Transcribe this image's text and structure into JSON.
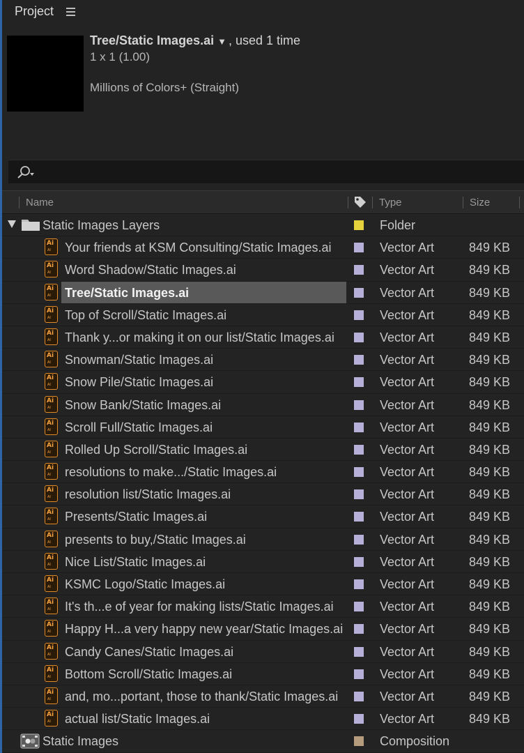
{
  "panel": {
    "title": "Project"
  },
  "info": {
    "file_name": "Tree/Static Images.ai",
    "arrow": "▼",
    "usage": ", used 1 time",
    "dimensions": "1 x 1 (1.00)",
    "color_depth": "Millions of Colors+ (Straight)"
  },
  "search": {
    "value": ""
  },
  "columns": {
    "name": "Name",
    "type": "Type",
    "size": "Size"
  },
  "colors": {
    "folder_label": "#e6d23c",
    "vector_label": "#b6b0d8",
    "comp_label": "#b49c7c",
    "accent": "#2f64a6"
  },
  "folder": {
    "name": "Static Images Layers",
    "type": "Folder",
    "icon": "folder-icon"
  },
  "items": [
    {
      "name": "Your friends at KSM Consulting/Static Images.ai",
      "type": "Vector Art",
      "size": "849 KB"
    },
    {
      "name": "Word Shadow/Static Images.ai",
      "type": "Vector Art",
      "size": "849 KB"
    },
    {
      "name": "Tree/Static Images.ai",
      "type": "Vector Art",
      "size": "849 KB",
      "selected": true
    },
    {
      "name": "Top of Scroll/Static Images.ai",
      "type": "Vector Art",
      "size": "849 KB"
    },
    {
      "name": "Thank y...or making it on our list/Static Images.ai",
      "type": "Vector Art",
      "size": "849 KB"
    },
    {
      "name": "Snowman/Static Images.ai",
      "type": "Vector Art",
      "size": "849 KB"
    },
    {
      "name": "Snow Pile/Static Images.ai",
      "type": "Vector Art",
      "size": "849 KB"
    },
    {
      "name": "Snow Bank/Static Images.ai",
      "type": "Vector Art",
      "size": "849 KB"
    },
    {
      "name": "Scroll Full/Static Images.ai",
      "type": "Vector Art",
      "size": "849 KB"
    },
    {
      "name": "Rolled Up Scroll/Static Images.ai",
      "type": "Vector Art",
      "size": "849 KB"
    },
    {
      "name": "resolutions to make.../Static Images.ai",
      "type": "Vector Art",
      "size": "849 KB"
    },
    {
      "name": "resolution list/Static Images.ai",
      "type": "Vector Art",
      "size": "849 KB"
    },
    {
      "name": "Presents/Static Images.ai",
      "type": "Vector Art",
      "size": "849 KB"
    },
    {
      "name": "presents to buy,/Static Images.ai",
      "type": "Vector Art",
      "size": "849 KB"
    },
    {
      "name": "Nice List/Static Images.ai",
      "type": "Vector Art",
      "size": "849 KB"
    },
    {
      "name": "KSMC Logo/Static Images.ai",
      "type": "Vector Art",
      "size": "849 KB"
    },
    {
      "name": "It's th...e of year for making lists/Static Images.ai",
      "type": "Vector Art",
      "size": "849 KB"
    },
    {
      "name": "Happy H...a very happy new year/Static Images.ai",
      "type": "Vector Art",
      "size": "849 KB"
    },
    {
      "name": "Candy Canes/Static Images.ai",
      "type": "Vector Art",
      "size": "849 KB"
    },
    {
      "name": "Bottom Scroll/Static Images.ai",
      "type": "Vector Art",
      "size": "849 KB"
    },
    {
      "name": "and, mo...portant, those to thank/Static Images.ai",
      "type": "Vector Art",
      "size": "849 KB"
    },
    {
      "name": "actual list/Static Images.ai",
      "type": "Vector Art",
      "size": "849 KB"
    }
  ],
  "composition": {
    "name": "Static Images",
    "type": "Composition",
    "icon": "composition-icon"
  },
  "ai_badge": {
    "main": "Ai",
    "sub": "AI"
  }
}
